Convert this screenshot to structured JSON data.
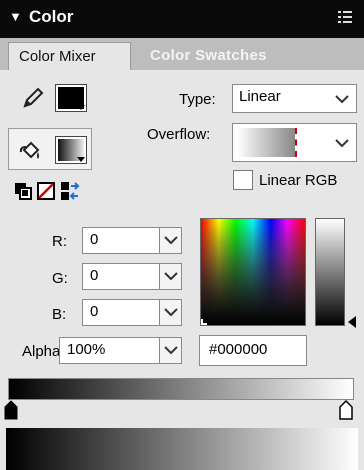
{
  "panel": {
    "title": "Color",
    "collapse_arrow": "▼",
    "menu_icon": "panel-menu-icon"
  },
  "tabs": [
    {
      "label": "Color Mixer",
      "active": true
    },
    {
      "label": "Color Swatches",
      "active": false
    }
  ],
  "stroke": {
    "icon": "pencil-icon",
    "color": "#000000"
  },
  "fill": {
    "icon": "paint-bucket-icon",
    "color": "linear-gradient-black-white"
  },
  "tools": {
    "swap_default": "black-white-icon",
    "no_color": "no-color-icon",
    "swap_colors": "swap-colors-icon"
  },
  "type": {
    "label": "Type:",
    "value": "Linear"
  },
  "overflow": {
    "label": "Overflow:"
  },
  "linear_rgb": {
    "label": "Linear RGB",
    "checked": false
  },
  "rgb": [
    {
      "label": "R:",
      "value": "0"
    },
    {
      "label": "G:",
      "value": "0"
    },
    {
      "label": "B:",
      "value": "0"
    }
  ],
  "alpha": {
    "label": "Alpha:",
    "value": "100%"
  },
  "hex": {
    "value": "#000000"
  },
  "colors": {
    "titlebar": "#0a0a0a",
    "panel_bg": "#e6e6e6",
    "tab_strip": "#bdbdbd",
    "accent_red": "#cc0000"
  }
}
